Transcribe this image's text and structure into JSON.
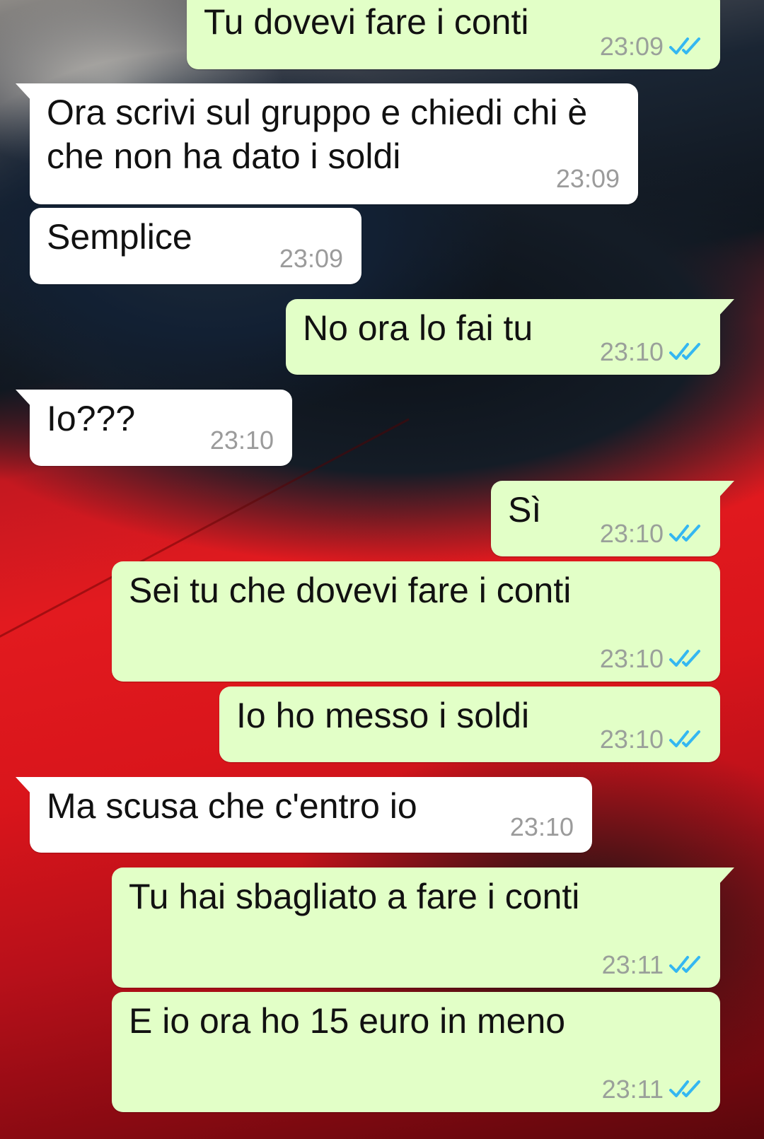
{
  "messages": [
    {
      "dir": "out",
      "text": "Tu dovevi fare i conti",
      "time": "23:09",
      "status": "read"
    },
    {
      "dir": "in",
      "text": "Ora scrivi sul gruppo e chiedi chi è che non ha dato i soldi",
      "time": "23:09"
    },
    {
      "dir": "in",
      "text": "Semplice",
      "time": "23:09"
    },
    {
      "dir": "out",
      "text": "No ora lo fai tu",
      "time": "23:10",
      "status": "read"
    },
    {
      "dir": "in",
      "text": "Io???",
      "time": "23:10"
    },
    {
      "dir": "out",
      "text": "Sì",
      "time": "23:10",
      "status": "read"
    },
    {
      "dir": "out",
      "text": "Sei tu che dovevi fare i conti",
      "time": "23:10",
      "status": "read"
    },
    {
      "dir": "out",
      "text": "Io ho messo i soldi",
      "time": "23:10",
      "status": "read"
    },
    {
      "dir": "in",
      "text": "Ma scusa che c'entro io",
      "time": "23:10"
    },
    {
      "dir": "out",
      "text": "Tu hai sbagliato a fare i conti",
      "time": "23:11",
      "status": "read"
    },
    {
      "dir": "out",
      "text": "E io ora ho 15 euro in meno",
      "time": "23:11",
      "status": "read"
    }
  ],
  "icons": {
    "read_receipt": "double-check-icon"
  },
  "colors": {
    "outgoing_bubble": "#e2ffc7",
    "incoming_bubble": "#ffffff",
    "read_tick": "#34b7f1",
    "timestamp": "#9aa09a"
  }
}
